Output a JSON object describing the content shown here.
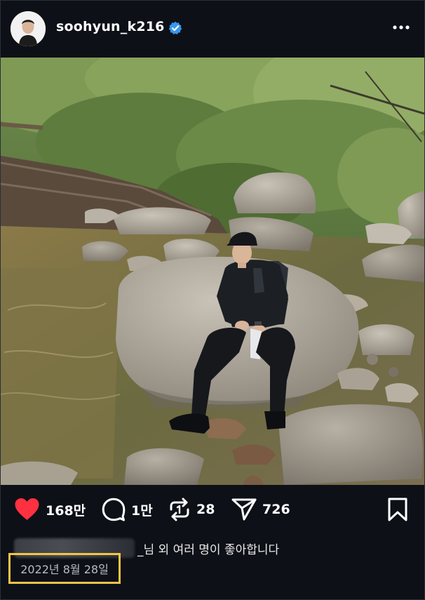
{
  "profile": {
    "username": "soohyun_k216",
    "verified_icon": "verified-badge-icon",
    "more_icon": "more-options-icon"
  },
  "post": {
    "image_alt": "",
    "actions": {
      "like": {
        "icon": "heart-filled-icon",
        "count": "168만",
        "color": "#ff3040"
      },
      "comment": {
        "icon": "comment-icon",
        "count": "1만"
      },
      "repost": {
        "icon": "repost-icon",
        "count": "28"
      },
      "share": {
        "icon": "send-icon",
        "count": "726"
      },
      "save": {
        "icon": "bookmark-icon"
      }
    },
    "likes_text": "_님 외 여러 명이 좋아합니다",
    "date": "2022년 8월 28일",
    "highlight_color": "#f3c544"
  }
}
